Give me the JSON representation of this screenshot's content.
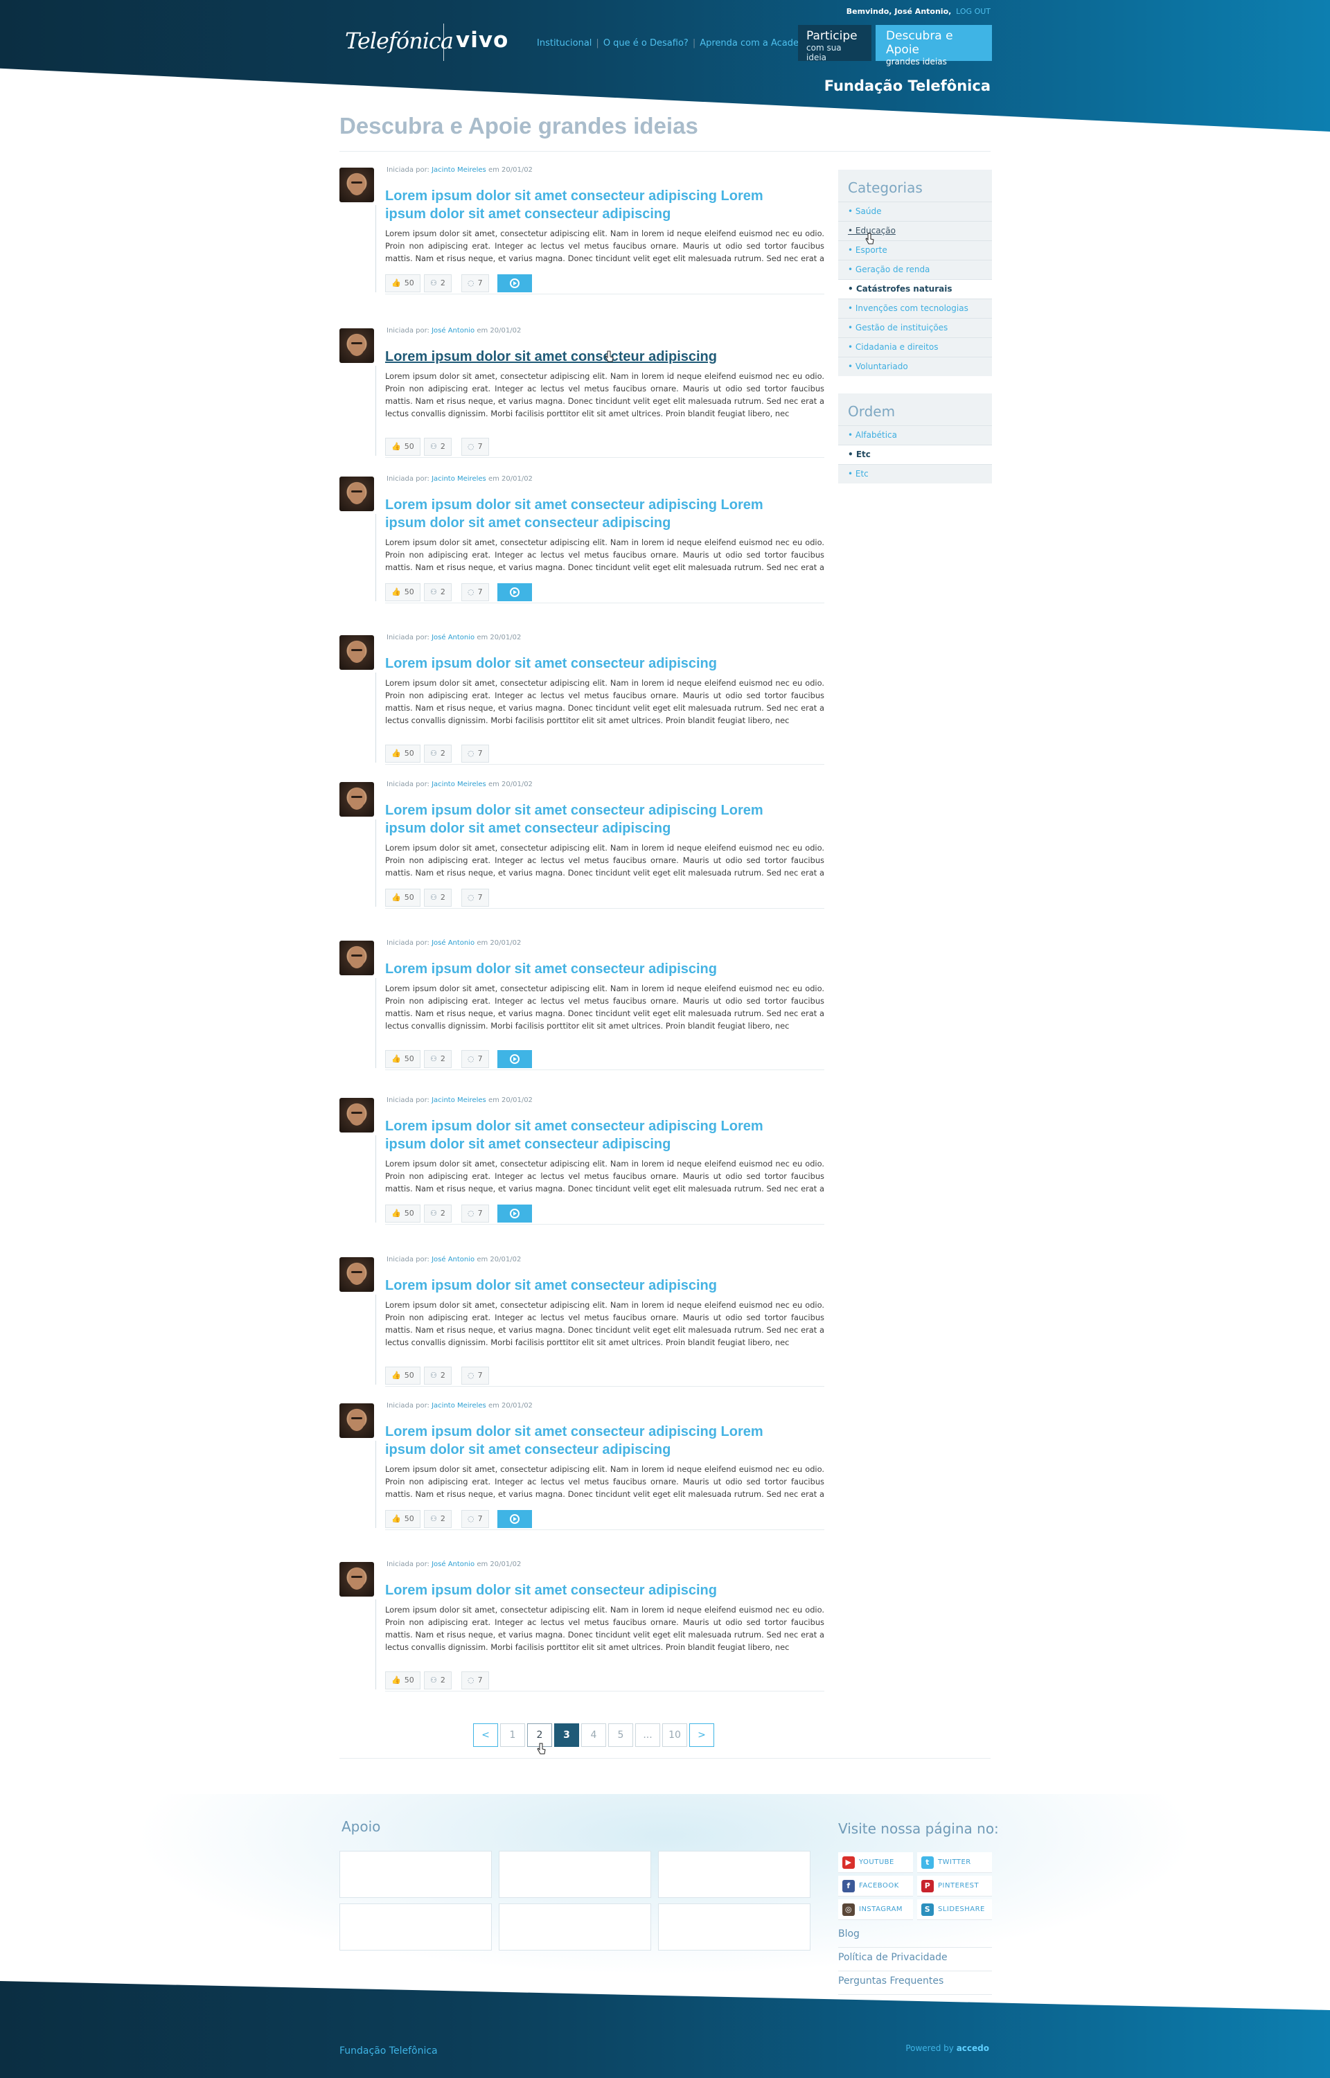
{
  "header": {
    "welcome": "Bemvindo, José Antonio,",
    "logout": "LOG OUT",
    "logo_telefonica": "Telefónica",
    "logo_vivo": "vivo",
    "nav": [
      "Institucional",
      "O que é o Desafio?",
      "Aprenda com a Academia"
    ],
    "participe": {
      "line1": "Participe",
      "line2": "com sua ideia"
    },
    "descubra": {
      "line1": "Descubra e Apoie",
      "line2": "grandes ideias"
    },
    "fundacao": "Fundação Telefônica"
  },
  "page_title": "Descubra e Apoie grandes ideias",
  "post_meta": {
    "prefix": "Iniciada por:",
    "date_text": "em 20/01/02"
  },
  "posts": [
    {
      "author": "Jacinto Meireles",
      "title": "Lorem ipsum dolor sit amet consecteur adipiscing Lorem ipsum dolor sit amet consecteur adipiscing",
      "likes": "50",
      "supporters": "2",
      "comments": "7",
      "has_video": true
    },
    {
      "author": "José Antonio",
      "title": "Lorem ipsum dolor sit amet consecteur adipiscing",
      "likes": "50",
      "supporters": "2",
      "comments": "7",
      "has_video": false
    },
    {
      "author": "Jacinto Meireles",
      "title": "Lorem ipsum dolor sit amet consecteur adipiscing Lorem ipsum dolor sit amet consecteur adipiscing",
      "likes": "50",
      "supporters": "2",
      "comments": "7",
      "has_video": true
    },
    {
      "author": "José Antonio",
      "title": "Lorem ipsum dolor sit amet consecteur adipiscing",
      "likes": "50",
      "supporters": "2",
      "comments": "7",
      "has_video": false
    },
    {
      "author": "Jacinto Meireles",
      "title": "Lorem ipsum dolor sit amet consecteur adipiscing Lorem ipsum dolor sit amet consecteur adipiscing",
      "likes": "50",
      "supporters": "2",
      "comments": "7",
      "has_video": false
    },
    {
      "author": "José Antonio",
      "title": "Lorem ipsum dolor sit amet consecteur adipiscing",
      "likes": "50",
      "supporters": "2",
      "comments": "7",
      "has_video": true
    },
    {
      "author": "Jacinto Meireles",
      "title": "Lorem ipsum dolor sit amet consecteur adipiscing Lorem ipsum dolor sit amet consecteur adipiscing",
      "likes": "50",
      "supporters": "2",
      "comments": "7",
      "has_video": true
    },
    {
      "author": "José Antonio",
      "title": "Lorem ipsum dolor sit amet consecteur adipiscing",
      "likes": "50",
      "supporters": "2",
      "comments": "7",
      "has_video": false
    },
    {
      "author": "Jacinto Meireles",
      "title": "Lorem ipsum dolor sit amet consecteur adipiscing Lorem ipsum dolor sit amet consecteur adipiscing",
      "likes": "50",
      "supporters": "2",
      "comments": "7",
      "has_video": true
    },
    {
      "author": "José Antonio",
      "title": "Lorem ipsum dolor sit amet consecteur adipiscing",
      "likes": "50",
      "supporters": "2",
      "comments": "7",
      "has_video": false
    }
  ],
  "body_text": "Lorem ipsum dolor sit amet, consectetur adipiscing elit. Nam in lorem id neque eleifend euismod nec eu odio. Proin non adipiscing erat. Integer ac lectus vel metus faucibus ornare. Mauris ut odio sed tortor faucibus mattis. Nam et risus neque, et varius magna. Donec tincidunt velit eget elit malesuada rutrum. Sed nec erat a lectus convallis dignissim. Morbi facilisis porttitor elit sit amet ultrices. Proin blandit feugiat libero, nec",
  "sidebar": {
    "categorias_title": "Categorias",
    "categorias": [
      "Saúde",
      "Educação",
      "Esporte",
      "Geração de renda",
      "Catástrofes naturais",
      "Invenções com tecnologias",
      "Gestão de instituições",
      "Cidadania e direitos",
      "Voluntariado"
    ],
    "active_category": "Catástrofes naturais",
    "ordem_title": "Ordem",
    "ordem": [
      "Alfabética",
      "Etc",
      "Etc"
    ],
    "active_ordem": "Etc"
  },
  "pagination": {
    "prev": "<",
    "pages": [
      "1",
      "2",
      "3",
      "4",
      "5",
      "...",
      "10"
    ],
    "next": ">",
    "current": "3"
  },
  "footer": {
    "apoio": "Apoio",
    "visite": "Visite nossa página no:",
    "social": [
      {
        "label": "YOUTUBE",
        "icon": "youtube-icon",
        "color": "#d9302b"
      },
      {
        "label": "TWITTER",
        "icon": "twitter-icon",
        "color": "#41b7e9"
      },
      {
        "label": "FACEBOOK",
        "icon": "facebook-icon",
        "color": "#3b5998"
      },
      {
        "label": "PINTEREST",
        "icon": "pinterest-icon",
        "color": "#c8232c"
      },
      {
        "label": "INSTAGRAM",
        "icon": "instagram-icon",
        "color": "#5a4637"
      },
      {
        "label": "SLIDESHARE",
        "icon": "slideshare-icon",
        "color": "#2b8fbd"
      }
    ],
    "links": [
      "Blog",
      "Política de Privacidade",
      "Perguntas Frequentes"
    ],
    "name": "Fundação Telefônica",
    "powered_prefix": "Powered by",
    "powered_brand": "accedo"
  },
  "colors": {
    "accent": "#3fb4e5",
    "dark": "#0c3d58",
    "active": "#1f5a77"
  }
}
